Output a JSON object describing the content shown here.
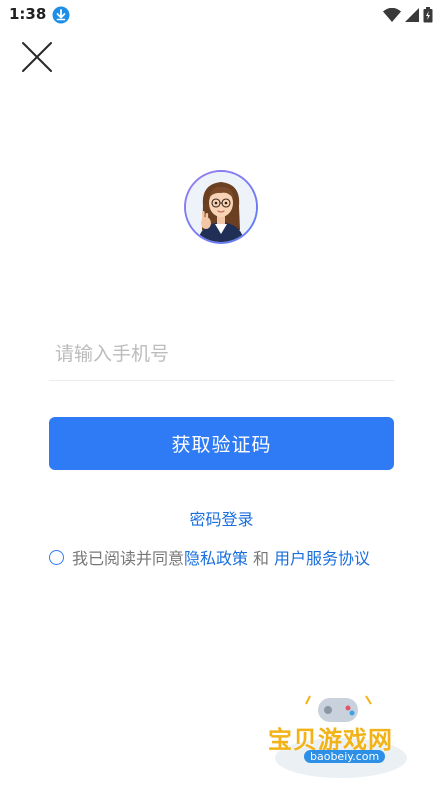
{
  "status_bar": {
    "time": "1:38"
  },
  "icons": {
    "close": "close-icon",
    "download": "download-icon",
    "wifi": "wifi-icon",
    "signal": "signal-icon",
    "battery": "battery-icon"
  },
  "login": {
    "phone_placeholder": "请输入手机号",
    "get_code_label": "获取验证码",
    "password_login_label": "密码登录"
  },
  "agreement": {
    "prefix": "我已阅读并同意",
    "privacy_label": "隐私政策",
    "and_label": "和",
    "terms_label": "用户服务协议",
    "checked": false
  },
  "watermark": {
    "title": "宝贝游戏网",
    "url": "baobeiy.com"
  },
  "colors": {
    "primary": "#2f7bf5",
    "link": "#1a6fdc"
  }
}
